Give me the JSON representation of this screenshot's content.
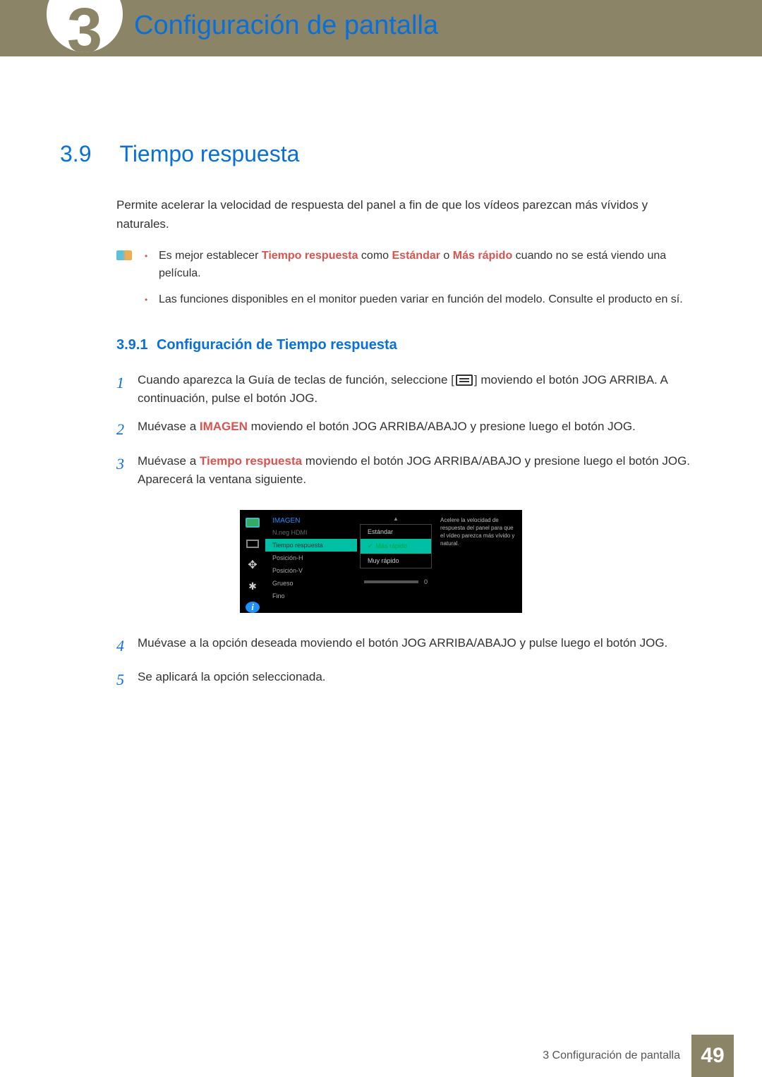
{
  "header": {
    "chapter_title": "Configuración de pantalla",
    "chapter_number": "3"
  },
  "section": {
    "number": "3.9",
    "title": "Tiempo respuesta",
    "intro": "Permite acelerar la velocidad de respuesta del panel a fin de que los vídeos parezcan más vívidos y naturales."
  },
  "info_bullets": {
    "b1_pre": "Es mejor establecer ",
    "b1_k1": "Tiempo respuesta",
    "b1_mid1": " como ",
    "b1_k2": "Estándar",
    "b1_mid2": " o ",
    "b1_k3": "Más rápido",
    "b1_post": " cuando no se está viendo una película.",
    "b2": "Las funciones disponibles en el monitor pueden variar en función del modelo. Consulte el producto en sí."
  },
  "subsection": {
    "number": "3.9.1",
    "title": "Configuración de Tiempo respuesta"
  },
  "steps": {
    "s1_a": "Cuando aparezca la Guía de teclas de función, seleccione [",
    "s1_b": "] moviendo el botón JOG ARRIBA. A continuación, pulse el botón JOG.",
    "s2_a": "Muévase a ",
    "s2_k": "IMAGEN",
    "s2_b": " moviendo el botón JOG ARRIBA/ABAJO y presione luego el botón JOG.",
    "s3_a": "Muévase a ",
    "s3_k": "Tiempo respuesta",
    "s3_b": " moviendo el botón JOG ARRIBA/ABAJO y presione luego el botón JOG. Aparecerá la ventana siguiente.",
    "s4": "Muévase a la opción deseada moviendo el botón JOG ARRIBA/ABAJO y pulse luego el botón JOG.",
    "s5": "Se aplicará la opción seleccionada."
  },
  "step_nums": {
    "n1": "1",
    "n2": "2",
    "n3": "3",
    "n4": "4",
    "n5": "5"
  },
  "osd": {
    "menu_title": "IMAGEN",
    "items": {
      "i0": "N.neg HDMI",
      "i1": "Tiempo respuesta",
      "i2": "Posición-H",
      "i3": "Posición-V",
      "i4": "Grueso",
      "i5": "Fino"
    },
    "options": {
      "o0": "Estándar",
      "o1": "Más rápido",
      "o2": "Muy rápido"
    },
    "slider_value": "0",
    "description": "Acelere la velocidad de respuesta del panel para que el vídeo parezca más vívido y natural."
  },
  "footer": {
    "text": "3 Configuración de pantalla",
    "page": "49"
  }
}
